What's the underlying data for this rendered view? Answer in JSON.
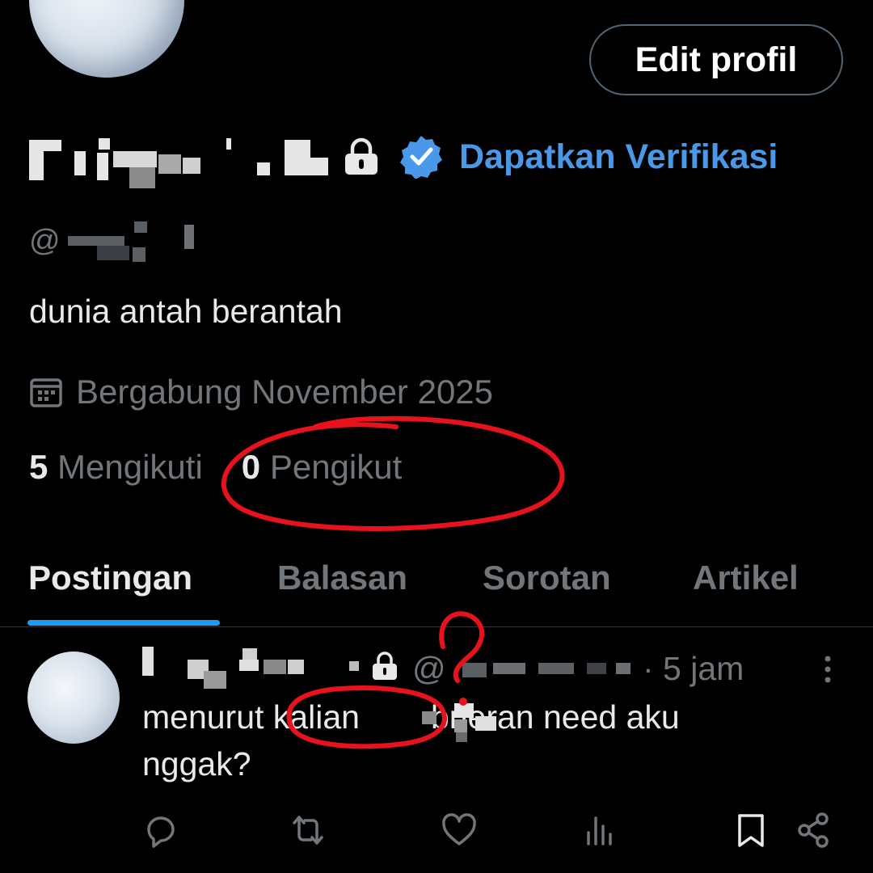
{
  "profile": {
    "edit_button": "Edit profil",
    "verify_link": "Dapatkan Verifikasi",
    "handle_prefix": "@",
    "bio": "dunia antah berantah",
    "joined": "Bergabung November 2025",
    "following_count": "5",
    "following_label": "Mengikuti",
    "followers_count": "0",
    "followers_label": "Pengikut"
  },
  "tabs": [
    {
      "label": "Postingan",
      "active": true
    },
    {
      "label": "Balasan",
      "active": false
    },
    {
      "label": "Sorotan",
      "active": false
    },
    {
      "label": "Artikel",
      "active": false
    }
  ],
  "post": {
    "handle_prefix": "@",
    "time": "· 5 jam",
    "text_part1": "menurut kalian",
    "text_part2": "bneran need aku",
    "text_part3": "nggak?"
  },
  "actions": [
    "reply-icon",
    "retweet-icon",
    "like-icon",
    "views-icon",
    "bookmark-icon",
    "share-icon"
  ],
  "colors": {
    "accent": "#1d9bf0",
    "verify": "#4a99e9",
    "annotation": "#e8121c"
  }
}
